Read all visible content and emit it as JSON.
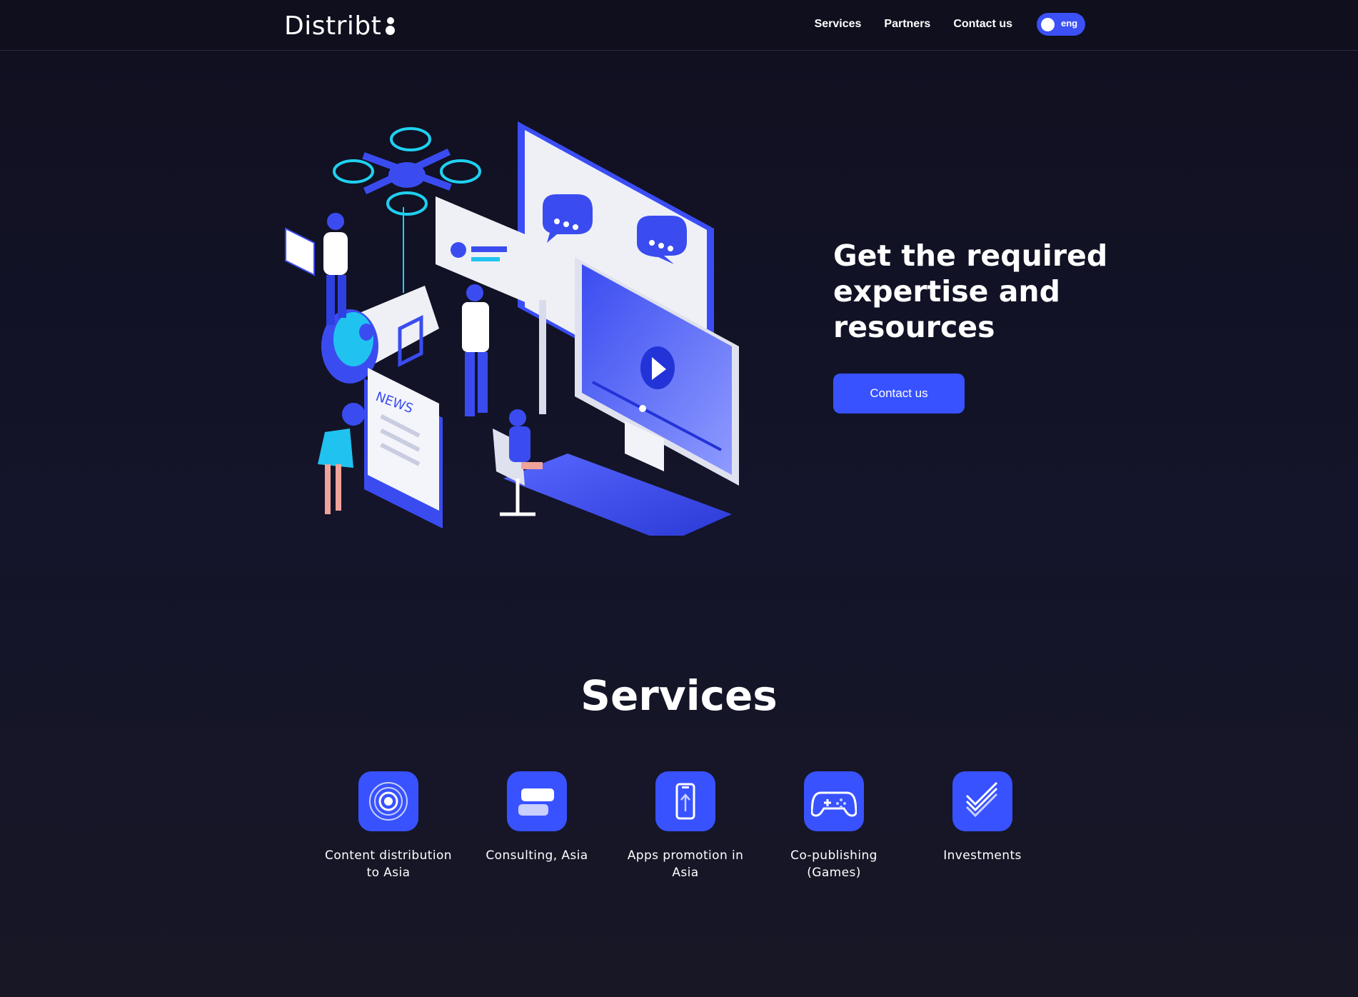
{
  "header": {
    "logo_text": "Distribt",
    "nav": [
      {
        "label": "Services"
      },
      {
        "label": "Partners"
      },
      {
        "label": "Contact us"
      }
    ],
    "language": "eng"
  },
  "hero": {
    "title": "Get the required expertise and resources",
    "cta_label": "Contact us",
    "illustration_text": "NEWS"
  },
  "services": {
    "title": "Services",
    "items": [
      {
        "label": "Content distribution to Asia",
        "icon": "target-icon"
      },
      {
        "label": "Consulting, Asia",
        "icon": "chat-bubbles-icon"
      },
      {
        "label": "Apps promotion in Asia",
        "icon": "phone-upload-icon"
      },
      {
        "label": "Co-publishing (Games)",
        "icon": "gamepad-icon"
      },
      {
        "label": "Investments",
        "icon": "growth-chart-icon"
      }
    ]
  },
  "colors": {
    "background": "#12121f",
    "accent": "#3852ff",
    "text": "#ffffff"
  }
}
